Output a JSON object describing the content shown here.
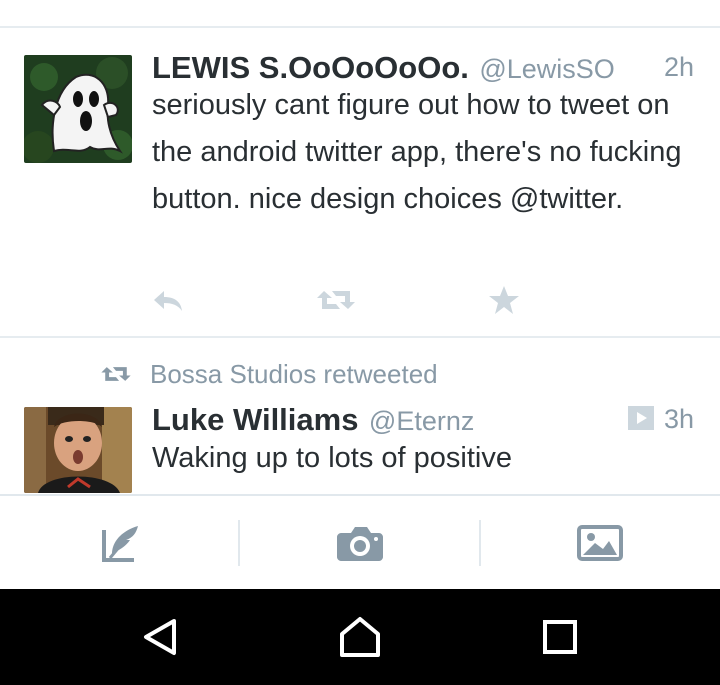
{
  "tweets": [
    {
      "name": "LEWIS S.OoOoOoOo.",
      "handle": "@LewisSO",
      "time": "2h",
      "text": "seriously cant figure out how to tweet on the android twitter app, there's no fucking button. nice design choices @twitter.",
      "avatar_icon": "ghost-avatar"
    },
    {
      "retweeted_by": "Bossa Studios retweeted",
      "name": "Luke Williams",
      "handle": "@Eternz",
      "time": "3h",
      "text": "Waking up to lots of positive",
      "media_icon": "video-icon",
      "avatar_icon": "person-avatar"
    }
  ],
  "actions": [
    "reply-icon",
    "retweet-icon",
    "favorite-star-icon"
  ],
  "compose_bar": [
    "compose-tweet-icon",
    "camera-icon",
    "photo-icon"
  ],
  "navbar": [
    "back-icon",
    "home-icon",
    "recent-apps-icon"
  ],
  "colors": {
    "text": "#292f33",
    "muted": "#8899a6",
    "icon": "#ccd6dd",
    "divider": "#e6ecf0",
    "compose_icon": "#8899a6",
    "navbar": "#000000"
  }
}
